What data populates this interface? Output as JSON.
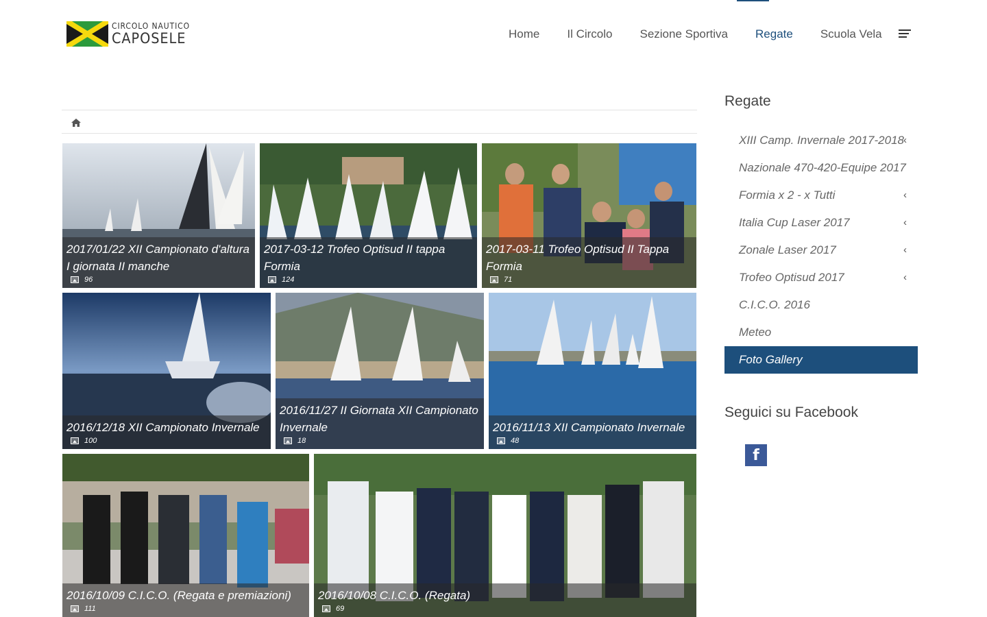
{
  "logo": {
    "line1": "CIRCOLO NAUTICO",
    "line2": "CAPOSELE"
  },
  "nav": {
    "items": [
      {
        "label": "Home"
      },
      {
        "label": "Il Circolo"
      },
      {
        "label": "Sezione Sportiva"
      },
      {
        "label": "Regate",
        "active": true
      },
      {
        "label": "Scuola Vela"
      }
    ]
  },
  "breadcrumb": {
    "icon": "home-icon"
  },
  "gallery": [
    {
      "title": "2017/01/22 XII Campionato d'altura I giornata II manche",
      "count": "96"
    },
    {
      "title": "2017-03-12 Trofeo Optisud II tappa Formia",
      "count": "124"
    },
    {
      "title": "2017-03-11 Trofeo Optisud II Tappa Formia",
      "count": "71"
    },
    {
      "title": "2016/12/18 XII Campionato Invernale",
      "count": "100"
    },
    {
      "title": "2016/11/27 II Giornata XII Campionato Invernale",
      "count": "18"
    },
    {
      "title": "2016/11/13 XII Campionato Invernale",
      "count": "48"
    },
    {
      "title": "2016/10/09 C.I.C.O. (Regata e premiazioni)",
      "count": "111"
    },
    {
      "title": "2016/10/08 C.I.C.O. (Regata)",
      "count": "69"
    }
  ],
  "sidebar": {
    "title": "Regate",
    "items": [
      {
        "label": "XIII Camp. Invernale 2017-2018",
        "chevron": "‹"
      },
      {
        "label": "Nazionale 470-420-Equipe 2017",
        "chevron": ""
      },
      {
        "label": "Formia x 2 - x Tutti",
        "chevron": "‹"
      },
      {
        "label": "Italia Cup Laser 2017",
        "chevron": "‹"
      },
      {
        "label": "Zonale Laser 2017",
        "chevron": "‹"
      },
      {
        "label": "Trofeo Optisud 2017",
        "chevron": "‹"
      },
      {
        "label": "C.I.C.O. 2016",
        "chevron": ""
      },
      {
        "label": "Meteo",
        "chevron": ""
      },
      {
        "label": "Foto Gallery",
        "chevron": "",
        "active": true
      }
    ],
    "facebook_title": "Seguici su Facebook",
    "facebook_icon": "f"
  },
  "colors": {
    "accent": "#1d4f7c",
    "facebook": "#3b5998"
  }
}
